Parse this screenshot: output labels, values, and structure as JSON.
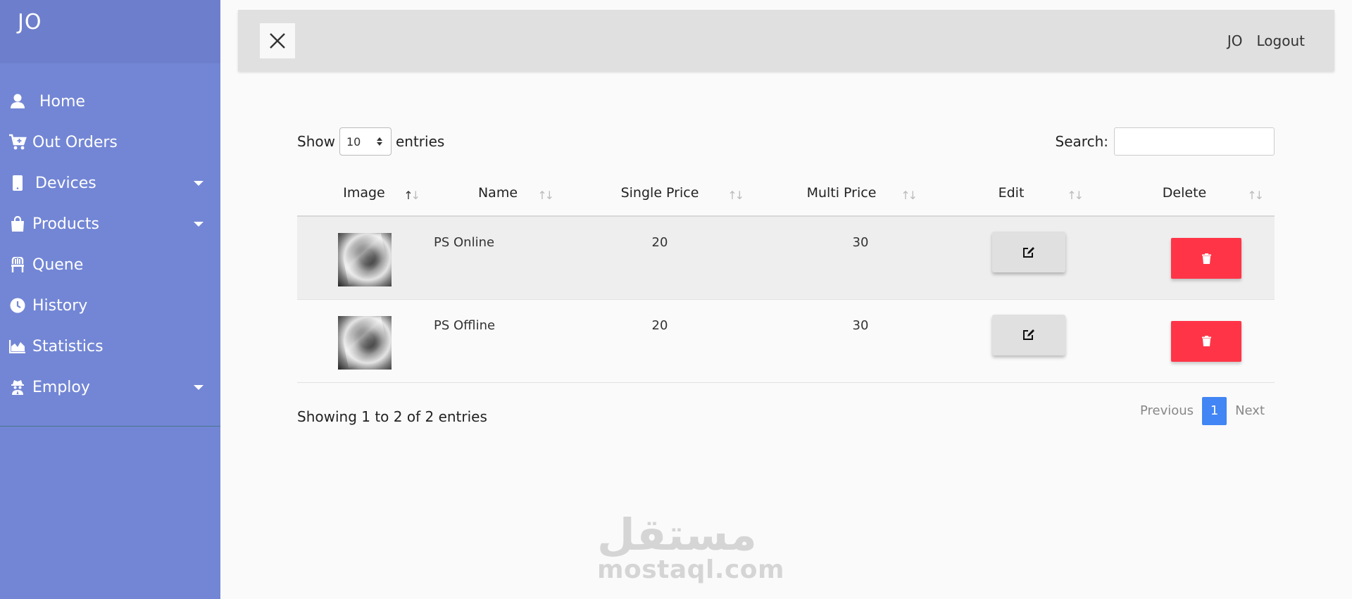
{
  "sidebar": {
    "brand": "JO",
    "items": [
      {
        "label": "Home",
        "icon": "user-icon"
      },
      {
        "label": "Out Orders",
        "icon": "cart-plus-icon"
      },
      {
        "label": "Devices",
        "icon": "mobile-icon",
        "dropdown": true
      },
      {
        "label": "Products",
        "icon": "shopping-bag-icon",
        "dropdown": true
      },
      {
        "label": "Quene",
        "icon": "chair-icon"
      },
      {
        "label": "History",
        "icon": "clock-icon"
      },
      {
        "label": "Statistics",
        "icon": "area-chart-icon"
      },
      {
        "label": "Employ",
        "icon": "user-secret-icon",
        "dropdown": true
      }
    ]
  },
  "topbar": {
    "user": "JO",
    "logout": "Logout"
  },
  "table_controls": {
    "show_label": "Show",
    "entries_value": "10",
    "entries_label": "entries",
    "search_label": "Search:",
    "search_value": ""
  },
  "table": {
    "headers": [
      "Image",
      "Name",
      "Single Price",
      "Multi Price",
      "Edit",
      "Delete"
    ],
    "rows": [
      {
        "name": "PS Online",
        "single_price": "20",
        "multi_price": "30"
      },
      {
        "name": "PS Offline",
        "single_price": "20",
        "multi_price": "30"
      }
    ]
  },
  "footer": {
    "info": "Showing 1 to 2 of 2 entries",
    "previous": "Previous",
    "current_page": "1",
    "next": "Next"
  },
  "watermark": {
    "arabic": "مستقل",
    "latin": "mostaql.com"
  },
  "colors": {
    "sidebar": "#7386d5",
    "sidebar_header": "#6d7fcc",
    "delete": "#ff3547",
    "page_active": "#4285f4"
  }
}
